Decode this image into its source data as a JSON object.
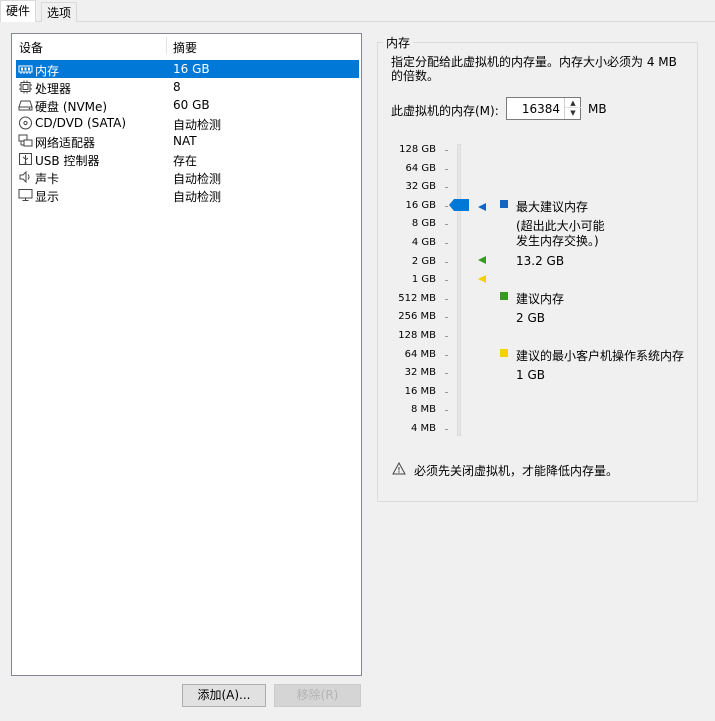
{
  "tabs": [
    {
      "label": "硬件",
      "active": true
    },
    {
      "label": "选项",
      "active": false
    }
  ],
  "device_list": {
    "headers": {
      "device": "设备",
      "summary": "摘要"
    },
    "items": [
      {
        "icon": "memory-icon",
        "name": "内存",
        "summary": "16 GB",
        "selected": true
      },
      {
        "icon": "processor-icon",
        "name": "处理器",
        "summary": "8",
        "selected": false
      },
      {
        "icon": "hard-disk-icon",
        "name": "硬盘 (NVMe)",
        "summary": "60 GB",
        "selected": false
      },
      {
        "icon": "cd-dvd-icon",
        "name": "CD/DVD (SATA)",
        "summary": "自动检测",
        "selected": false
      },
      {
        "icon": "network-adapter-icon",
        "name": "网络适配器",
        "summary": "NAT",
        "selected": false
      },
      {
        "icon": "usb-icon",
        "name": "USB 控制器",
        "summary": "存在",
        "selected": false
      },
      {
        "icon": "sound-card-icon",
        "name": "声卡",
        "summary": "自动检测",
        "selected": false
      },
      {
        "icon": "display-icon",
        "name": "显示",
        "summary": "自动检测",
        "selected": false
      }
    ]
  },
  "buttons": {
    "add": "添加(A)...",
    "remove": "移除(R)"
  },
  "memory_panel": {
    "group_title": "内存",
    "description": "指定分配给此虚拟机的内存量。内存大小必须为 4 MB 的倍数。",
    "memory_label": "此虚拟机的内存(M):",
    "memory_value": "16384",
    "unit": "MB",
    "scale_labels": [
      "128 GB",
      "64 GB",
      "32 GB",
      "16 GB",
      "8 GB",
      "4 GB",
      "2 GB",
      "1 GB",
      "512 MB",
      "256 MB",
      "128 MB",
      "64 MB",
      "32 MB",
      "16 MB",
      "8 MB",
      "4 MB"
    ],
    "slider_value": "16 GB",
    "legend": {
      "max_recommended": {
        "title": "最大建议内存",
        "note": "(超出此大小可能发生内存交换。)",
        "value": "13.2 GB",
        "color": "#1565c0"
      },
      "recommended": {
        "title": "建议内存",
        "value": "2 GB",
        "color": "#3a9a1e"
      },
      "min_guest": {
        "title": "建议的最小客户机操作系统内存",
        "value": "1 GB",
        "color": "#f2d300"
      }
    },
    "warning": "必须先关闭虚拟机，才能降低内存量。"
  }
}
